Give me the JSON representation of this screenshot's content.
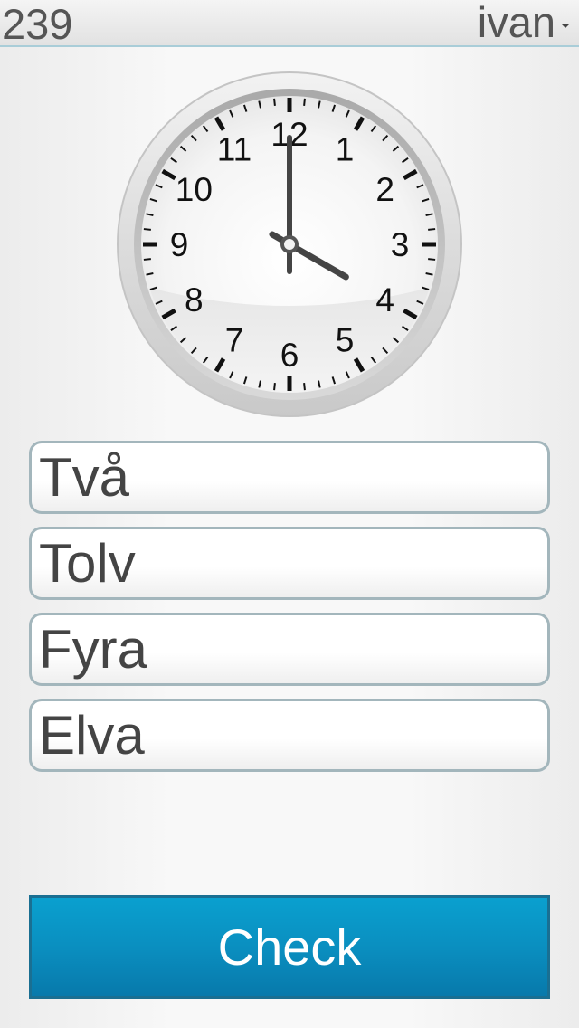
{
  "header": {
    "score": "239",
    "user_name": "ivan"
  },
  "clock": {
    "numerals": [
      "12",
      "1",
      "2",
      "3",
      "4",
      "5",
      "6",
      "7",
      "8",
      "9",
      "10",
      "11"
    ],
    "hour": 4,
    "minute": 0
  },
  "answers": [
    {
      "label": "Två"
    },
    {
      "label": "Tolv"
    },
    {
      "label": "Fyra"
    },
    {
      "label": "Elva"
    }
  ],
  "check_button": {
    "label": "Check"
  },
  "colors": {
    "accent": "#0a8fc0",
    "answer_border": "#a3b6bc",
    "text": "#444444"
  }
}
